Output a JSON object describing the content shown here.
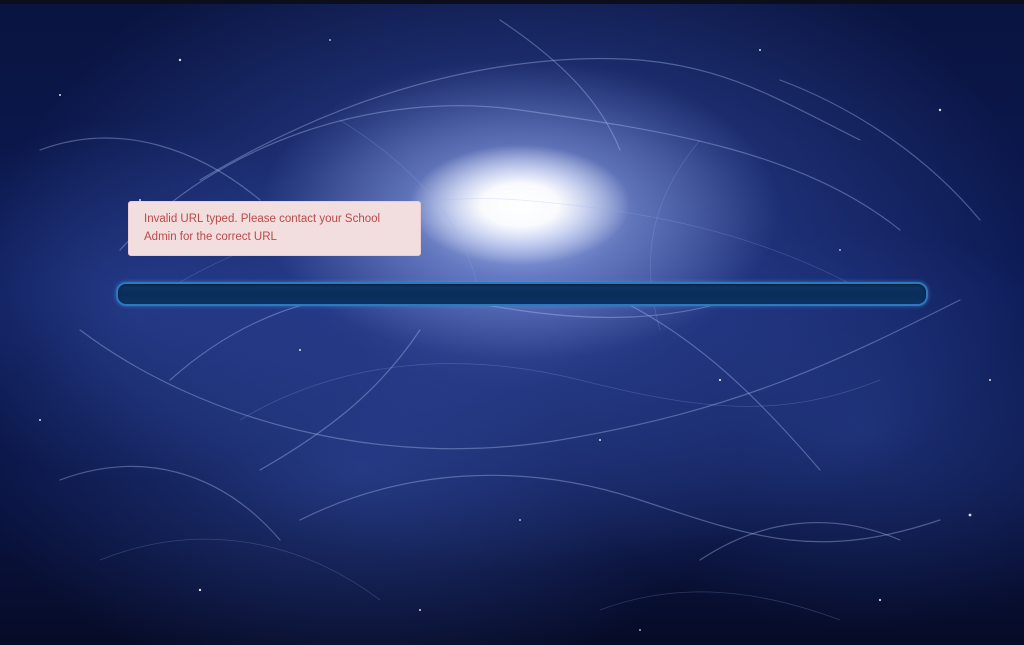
{
  "alert": {
    "message": "Invalid URL typed. Please contact your School Admin for the correct URL"
  },
  "url_input": {
    "value": "",
    "placeholder": ""
  },
  "colors": {
    "alert_background": "#f2dede",
    "alert_text": "#b94a48",
    "input_border": "#2a7ac0",
    "input_background": "#0a2d5a"
  }
}
